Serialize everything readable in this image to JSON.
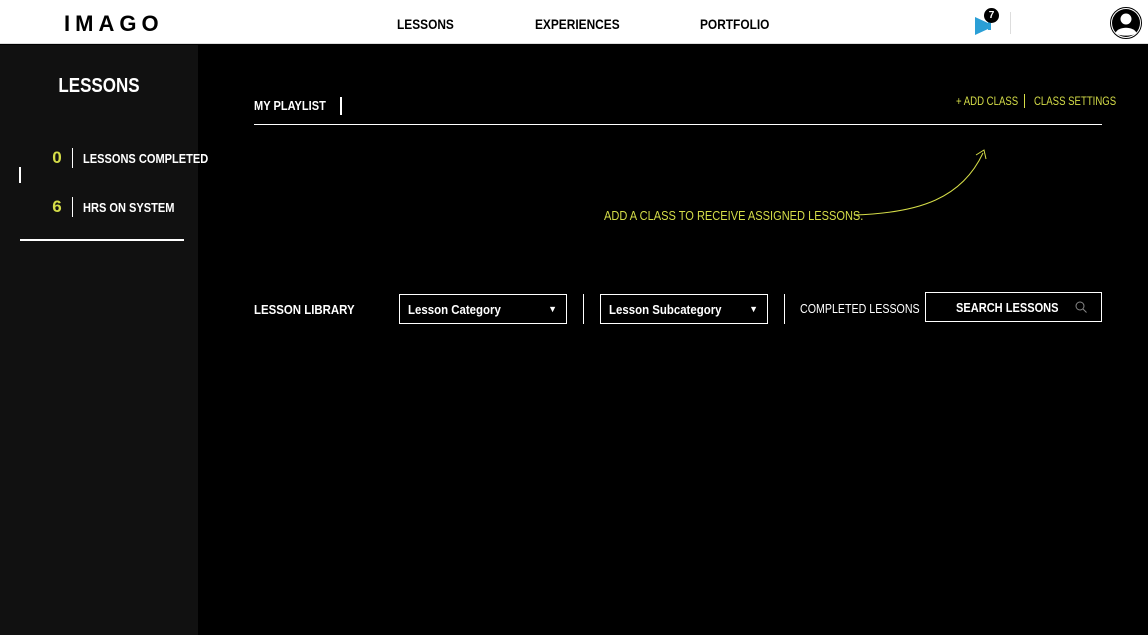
{
  "header": {
    "logo": "IMAGO",
    "nav": [
      "LESSONS",
      "EXPERIENCES",
      "PORTFOLIO"
    ],
    "notification_count": "7"
  },
  "sidebar": {
    "title": "LESSONS",
    "stats": [
      {
        "value": "0",
        "label": "LESSONS COMPLETED"
      },
      {
        "value": "6",
        "label": "HRS ON SYSTEM"
      }
    ]
  },
  "playlist": {
    "title": "MY PLAYLIST",
    "add_class": "+ ADD CLASS",
    "class_settings": "CLASS SETTINGS",
    "empty_message": "ADD A CLASS TO RECEIVE ASSIGNED LESSONS."
  },
  "library": {
    "title": "LESSON LIBRARY",
    "category_select": "Lesson Category",
    "subcategory_select": "Lesson Subcategory",
    "completed_lessons": "COMPLETED LESSONS",
    "search_label": "SEARCH LESSONS"
  },
  "colors": {
    "accent": "#d5dd48",
    "background": "#000000",
    "sidebar": "#111111",
    "topbar": "#ffffff"
  }
}
